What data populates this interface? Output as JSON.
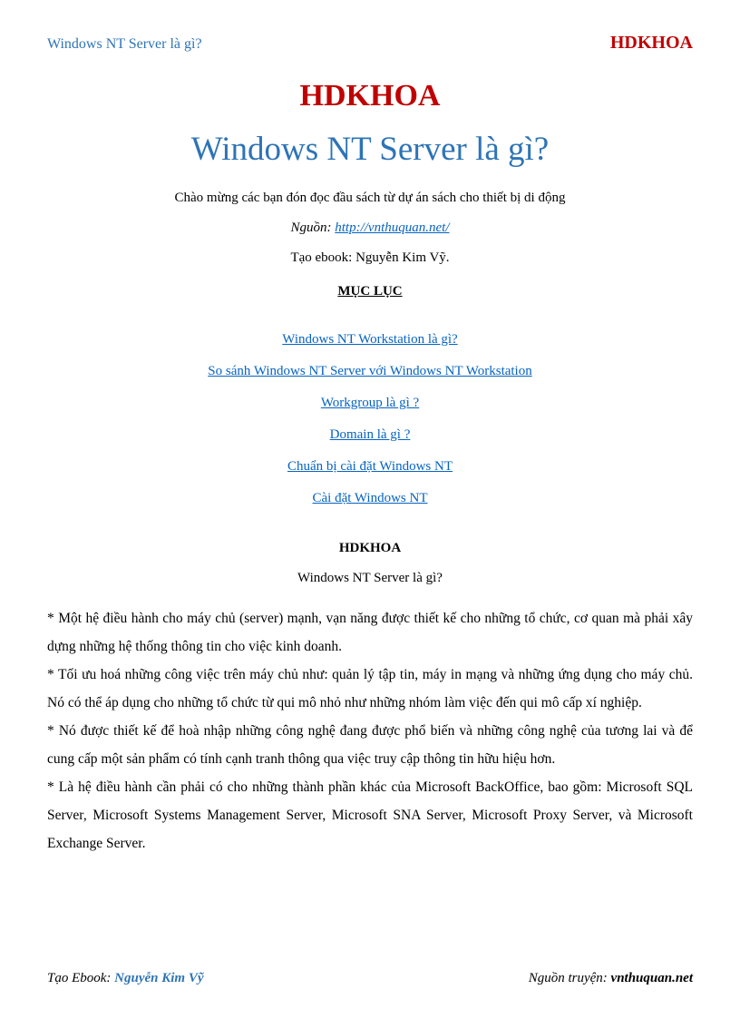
{
  "header": {
    "left": "Windows NT Server là gì?",
    "right": "HDKHOA"
  },
  "title": {
    "brand": "HDKHOA",
    "main": "Windows NT Server là gì?"
  },
  "intro": "Chào mừng các bạn đón đọc đầu sách từ dự án sách cho thiết bị di động",
  "source": {
    "label": "Nguồn: ",
    "url": "http://vnthuquan.net/"
  },
  "author_line": "Tạo ebook: Nguyễn Kim Vỹ.",
  "toc": {
    "title": "MỤC LỤC",
    "items": [
      "Windows NT Workstation là gì?",
      "So sánh Windows NT Server với Windows NT Workstation",
      "Workgroup là gì ?",
      "Domain là gì ?",
      "Chuẩn bị cài đặt Windows NT",
      "Cài đặt Windows NT"
    ]
  },
  "section": {
    "brand": "HDKHOA",
    "title": "Windows NT Server là gì?"
  },
  "paragraphs": [
    "* Một hệ điều hành cho máy chủ (server) mạnh, vạn năng được thiết kế cho những tổ chức, cơ quan mà phải xây dựng những hệ thống thông tin cho việc kinh doanh.",
    "* Tối ưu hoá những công việc trên máy chủ như: quản lý tập tin, máy in mạng và những ứng dụng cho máy chủ. Nó có thể áp dụng cho những tổ chức từ qui mô nhỏ như những nhóm làm việc đến qui mô cấp xí nghiệp.",
    "* Nó được thiết kế để hoà nhập những công nghệ đang được phổ biến và những công nghệ của tương lai và để cung cấp một sản phẩm có tính cạnh tranh thông qua việc truy cập thông tin hữu hiệu hơn.",
    "* Là hệ điều hành cần phải có cho những thành phần khác của Microsoft BackOffice, bao gồm: Microsoft SQL Server, Microsoft Systems Management Server, Microsoft SNA Server, Microsoft Proxy Server, và Microsoft Exchange Server."
  ],
  "footer": {
    "left_label": "Tạo Ebook",
    "left_name": "Nguyễn Kim Vỹ",
    "right_label": "Nguồn truyện",
    "right_src": "vnthuquan.net"
  }
}
